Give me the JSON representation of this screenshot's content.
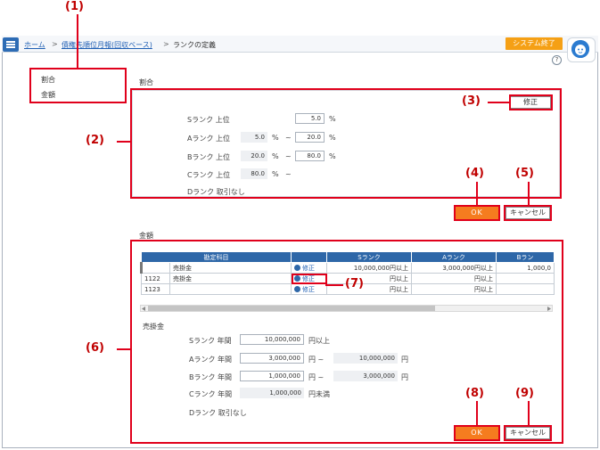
{
  "callouts": [
    "(1)",
    "(2)",
    "(3)",
    "(4)",
    "(5)",
    "(6)",
    "(7)",
    "(8)",
    "(9)"
  ],
  "header": {
    "breadcrumb": [
      "ホーム",
      ">",
      "債権先順位月報(回収ベース)",
      ">",
      "ランクの定義"
    ],
    "system_exit": "システム終了",
    "help": "?"
  },
  "side_menu": [
    "割合",
    "金額"
  ],
  "ratio": {
    "title": "割合",
    "edit_button": "修正",
    "rows": [
      {
        "label": "Sランク 上位",
        "from": "",
        "to": "5.0",
        "unit": "%"
      },
      {
        "label": "Aランク 上位",
        "from": "5.0",
        "to": "20.0",
        "unit": "%"
      },
      {
        "label": "Bランク 上位",
        "from": "20.0",
        "to": "80.0",
        "unit": "%"
      },
      {
        "label": "Cランク 上位",
        "from": "80.0",
        "to": "",
        "unit": "%"
      },
      {
        "label": "Dランク 取引なし",
        "from": "",
        "to": "",
        "unit": ""
      }
    ],
    "tilde": "~",
    "ok": "OK",
    "cancel": "キャンセル"
  },
  "amount": {
    "title": "金額",
    "columns": [
      "勘定科目",
      "",
      "Sランク",
      "Aランク",
      "Bラン"
    ],
    "rows": [
      {
        "code": "",
        "name": "売掛金",
        "edit": "修正",
        "s": "10,000,000円以上",
        "a": "3,000,000円以上",
        "b": "1,000,0"
      },
      {
        "code": "1122",
        "name": "売掛金",
        "edit": "修正",
        "s": "円以上",
        "a": "円以上",
        "b": ""
      },
      {
        "code": "1123",
        "name": "",
        "edit": "修正",
        "s": "円以上",
        "a": "円以上",
        "b": ""
      }
    ],
    "detail_title": "売掛金",
    "detail_rows": [
      {
        "label": "Sランク 年間",
        "from": "",
        "to": "10,000,000",
        "unit": "円以上"
      },
      {
        "label": "Aランク 年間",
        "from": "",
        "to": "3,000,000",
        "mid": "円 ~",
        "to2": "10,000,000",
        "unit": "円"
      },
      {
        "label": "Bランク 年間",
        "from": "",
        "to": "1,000,000",
        "mid": "円 ~",
        "to2": "3,000,000",
        "unit": "円"
      },
      {
        "label": "Cランク 年間",
        "from": "",
        "to": "1,000,000",
        "unit": "円未満"
      },
      {
        "label": "Dランク 取引なし"
      }
    ],
    "ok": "OK",
    "cancel": "キャンセル"
  }
}
